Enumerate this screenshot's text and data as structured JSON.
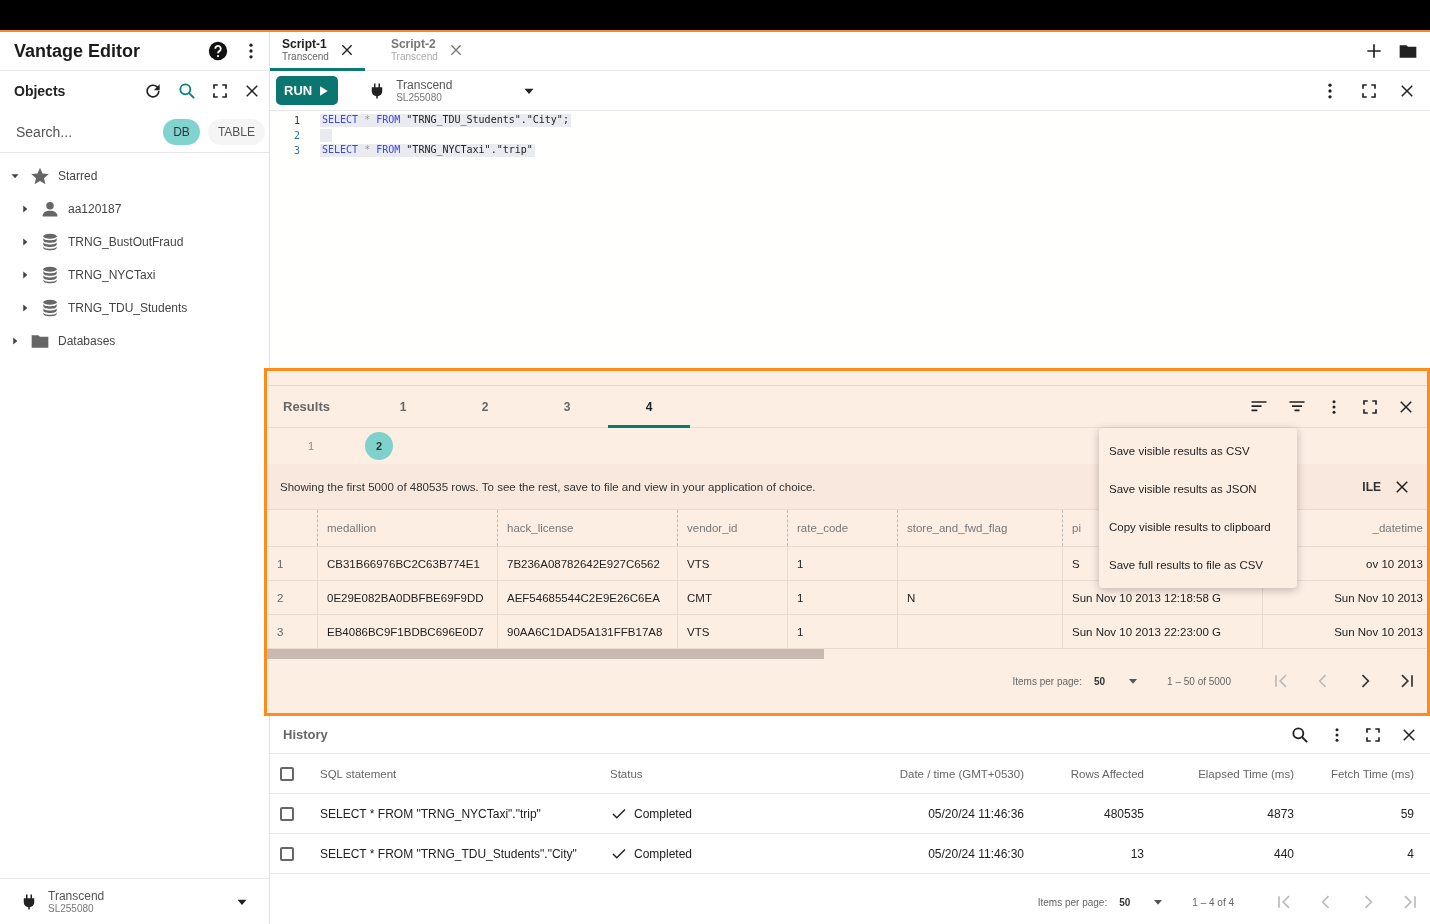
{
  "app": {
    "title": "Vantage Editor"
  },
  "objects": {
    "title": "Objects",
    "search": {
      "placeholder": "Search..."
    },
    "filters": [
      {
        "label": "DB",
        "selected": true
      },
      {
        "label": "TABLE",
        "selected": false
      }
    ],
    "tree": [
      {
        "label": "Starred",
        "kind": "starred",
        "expanded": true,
        "children": [
          {
            "label": "aa120187",
            "kind": "user",
            "expanded": false
          },
          {
            "label": "TRNG_BustOutFraud",
            "kind": "database",
            "expanded": false
          },
          {
            "label": "TRNG_NYCTaxi",
            "kind": "database",
            "expanded": false
          },
          {
            "label": "TRNG_TDU_Students",
            "kind": "database",
            "expanded": false
          }
        ]
      },
      {
        "label": "Databases",
        "kind": "folder",
        "expanded": false
      }
    ]
  },
  "sidebar_connection": {
    "name": "Transcend",
    "id": "SL255080"
  },
  "script_tabs": [
    {
      "title": "Script-1",
      "subtitle": "Transcend",
      "selected": true
    },
    {
      "title": "Script-2",
      "subtitle": "Transcend",
      "selected": false
    }
  ],
  "toolbar": {
    "run": "RUN",
    "connection": {
      "name": "Transcend",
      "id": "SL255080"
    }
  },
  "editor": {
    "lines": [
      {
        "number": "1",
        "highlighted": true,
        "tokens": [
          {
            "kind": "keyword",
            "text": "SELECT"
          },
          {
            "kind": "operator",
            "text": "*"
          },
          {
            "kind": "keyword",
            "text": "FROM"
          },
          {
            "kind": "string",
            "text": "\"TRNG_TDU_Students\".\"City\";"
          }
        ]
      },
      {
        "number": "2",
        "highlighted": true
      },
      {
        "number": "3",
        "highlighted": true,
        "tokens": [
          {
            "kind": "keyword",
            "text": "SELECT"
          },
          {
            "kind": "operator",
            "text": "*"
          },
          {
            "kind": "keyword",
            "text": "FROM"
          },
          {
            "kind": "string",
            "text": "\"TRNG_NYCTaxi\".\"trip\""
          }
        ]
      }
    ]
  },
  "results": {
    "title": "Results",
    "tabs": [
      {
        "label": "1",
        "selected": false
      },
      {
        "label": "2",
        "selected": false
      },
      {
        "label": "3",
        "selected": false
      },
      {
        "label": "4",
        "selected": true
      }
    ],
    "subtabs": [
      {
        "label": "1",
        "selected": false
      },
      {
        "label": "2",
        "selected": true
      }
    ],
    "notice": "Showing the first 5000 of 480535 rows. To see the rest, save to file and view in your application of choice.",
    "notice_action": "ILE",
    "menu": [
      "Save visible results as CSV",
      "Save visible results as JSON",
      "Copy visible results to clipboard",
      "Save full results to file as CSV"
    ],
    "table": {
      "columns": [
        "medallion",
        "hack_license",
        "vendor_id",
        "rate_code",
        "store_and_fwd_flag",
        "pi",
        "_datetime"
      ],
      "rows": [
        {
          "number": "1",
          "cells": [
            "CB31B66976BC2C63B774E1",
            "7B236A08782642E927C6562",
            "VTS",
            "1",
            null,
            "S",
            "ov 10 2013"
          ]
        },
        {
          "number": "2",
          "cells": [
            "0E29E082BA0DBFBE69F9DD",
            "AEF54685544C2E9E26C6EA",
            "CMT",
            "1",
            "N",
            "Sun Nov 10 2013 12:18:58 G",
            "Sun Nov 10 2013"
          ]
        },
        {
          "number": "3",
          "cells": [
            "EB4086BC9F1BDBC696E0D7",
            "90AA6C1DAD5A131FFB17A8",
            "VTS",
            "1",
            null,
            "Sun Nov 10 2013 22:23:00 G",
            "Sun Nov 10 2013"
          ]
        }
      ]
    },
    "pagination": {
      "items_label": "Items per page:",
      "page_size": "50",
      "range": "1 – 50 of 5000",
      "nav": [
        {
          "kind": "first",
          "disabled": true
        },
        {
          "kind": "previous",
          "disabled": true
        },
        {
          "kind": "next",
          "disabled": false
        },
        {
          "kind": "last",
          "disabled": false
        }
      ]
    }
  },
  "history": {
    "title": "History",
    "select_all_checked": false,
    "columns": [
      "SQL statement",
      "Status",
      "Date / time (GMT+0530)",
      "Rows Affected",
      "Elapsed Time (ms)",
      "Fetch Time (ms)"
    ],
    "rows": [
      {
        "checked": false,
        "statement": "SELECT * FROM \"TRNG_NYCTaxi\".\"trip\"",
        "status": "Completed",
        "date": "05/20/24 11:46:36",
        "rows_affected": "480535",
        "elapsed": "4873",
        "fetch": "59"
      },
      {
        "checked": false,
        "statement": "SELECT * FROM \"TRNG_TDU_Students\".\"City\"",
        "status": "Completed",
        "date": "05/20/24 11:46:30",
        "rows_affected": "13",
        "elapsed": "440",
        "fetch": "4"
      }
    ],
    "pagination": {
      "items_label": "Items per page:",
      "page_size": "50",
      "range": "1 – 4 of 4",
      "nav": [
        {
          "kind": "first",
          "disabled": true
        },
        {
          "kind": "previous",
          "disabled": true
        },
        {
          "kind": "next",
          "disabled": true
        },
        {
          "kind": "last",
          "disabled": true
        }
      ]
    }
  }
}
